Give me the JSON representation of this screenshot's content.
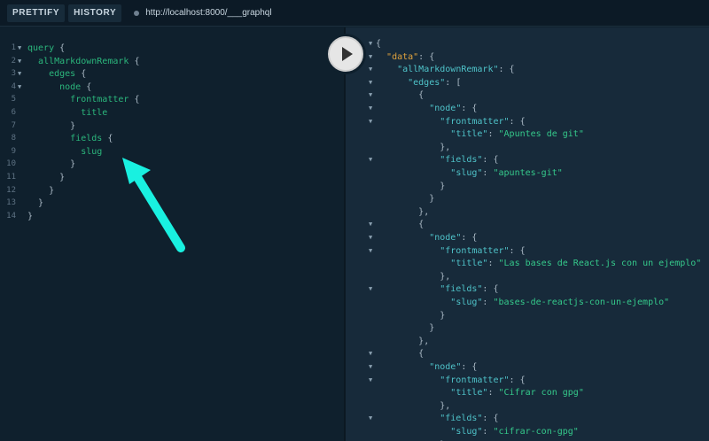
{
  "toolbar": {
    "prettify_label": "PRETTIFY",
    "history_label": "HISTORY",
    "url": "http://localhost:8000/___graphql"
  },
  "query_editor": {
    "line_numbers": [
      "1",
      "2",
      "3",
      "4",
      "5",
      "6",
      "7",
      "8",
      "9",
      "10",
      "11",
      "12",
      "13",
      "14"
    ],
    "lines": [
      "query {",
      "  allMarkdownRemark {",
      "    edges {",
      "      node {",
      "        frontmatter {",
      "          title",
      "        }",
      "        fields {",
      "          slug",
      "        }",
      "      }",
      "    }",
      "  }",
      "}"
    ]
  },
  "result_viewer": {
    "lines": [
      "{",
      "  \"data\": {",
      "    \"allMarkdownRemark\": {",
      "      \"edges\": [",
      "        {",
      "          \"node\": {",
      "            \"frontmatter\": {",
      "              \"title\": \"Apuntes de git\"",
      "            },",
      "            \"fields\": {",
      "              \"slug\": \"apuntes-git\"",
      "            }",
      "          }",
      "        },",
      "        {",
      "          \"node\": {",
      "            \"frontmatter\": {",
      "              \"title\": \"Las bases de React.js con un ejemplo\"",
      "            },",
      "            \"fields\": {",
      "              \"slug\": \"bases-de-reactjs-con-un-ejemplo\"",
      "            }",
      "          }",
      "        },",
      "        {",
      "          \"node\": {",
      "            \"frontmatter\": {",
      "              \"title\": \"Cifrar con gpg\"",
      "            },",
      "            \"fields\": {",
      "              \"slug\": \"cifrar-con-gpg\"",
      "            }"
    ]
  },
  "icons": {
    "play": "play-icon",
    "fold": "triangle-down-icon",
    "annotation": "arrow-icon"
  },
  "colors": {
    "annotation_arrow": "#19f0e0",
    "editor_bg": "#0f202d",
    "result_bg": "#172a3a",
    "keyword": "#2bb67c",
    "string": "#35c98b",
    "key": "#4fc3c9",
    "data_key": "#e1a33d"
  }
}
